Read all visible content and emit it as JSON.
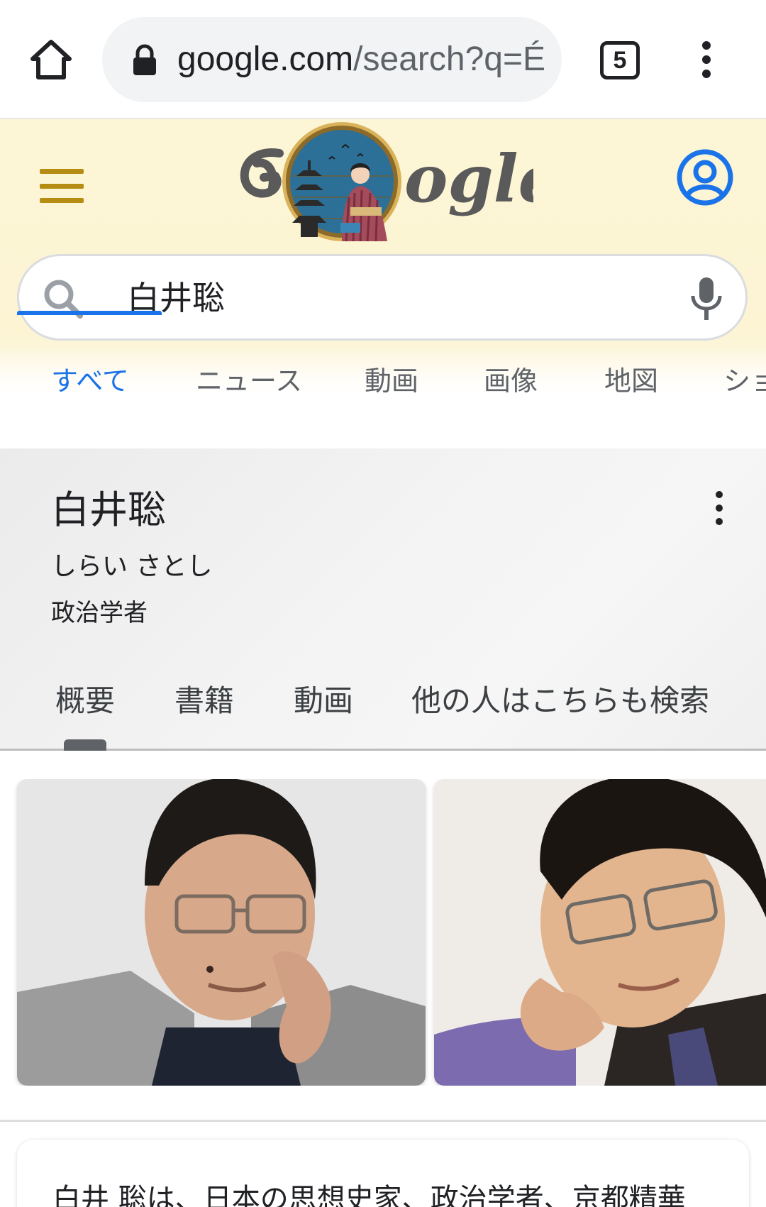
{
  "browser": {
    "url_host": "google.com",
    "url_path": "/search?q=É",
    "tab_count": "5"
  },
  "header": {
    "logo_letters": "ogle"
  },
  "search": {
    "query": "白井聡"
  },
  "search_tabs": [
    "すべて",
    "ニュース",
    "動画",
    "画像",
    "地図",
    "ショ"
  ],
  "knowledge_panel": {
    "title": "白井聡",
    "reading": "しらい さとし",
    "description": "政治学者",
    "tabs": [
      "概要",
      "書籍",
      "動画",
      "他の人はこちらも検索"
    ]
  },
  "summary": {
    "text": "白井 聡は、日本の思想史家、政治学者、京都精華"
  },
  "colors": {
    "accent_blue": "#1a73e8",
    "hamburger_gold": "#b58d12",
    "doodle_bg": "#fcf4d3"
  }
}
